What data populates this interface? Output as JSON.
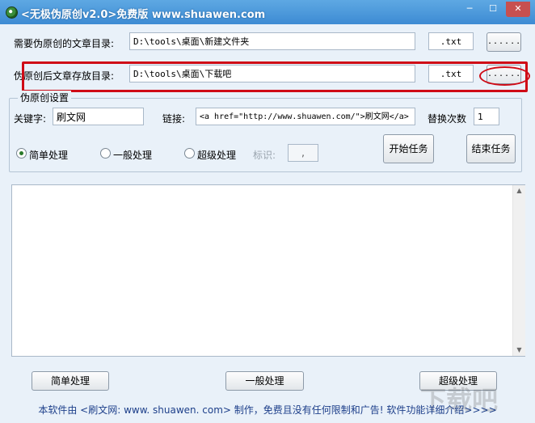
{
  "window": {
    "title": "<无极伪原创v2.0>免费版 www.shuawen.com",
    "controls": [
      "─",
      "☐",
      "✕"
    ]
  },
  "source_dir": {
    "label": "需要伪原创的文章目录:",
    "value": "D:\\tools\\桌面\\新建文件夹",
    "ext": ".txt",
    "browse": "......"
  },
  "target_dir": {
    "label": "伪原创后文章存放目录:",
    "value": "D:\\tools\\桌面\\下载吧",
    "ext": ".txt",
    "browse": "......"
  },
  "settings": {
    "group_title": "伪原创设置",
    "keyword_label": "关键字:",
    "keyword_value": "刷文网",
    "link_label": "链接:",
    "link_value": "<a href=\"http://www.shuawen.com/\">刷文网</a>",
    "replace_count_label": "替换次数",
    "replace_count_value": "1",
    "modes": [
      "简单处理",
      "一般处理",
      "超级处理"
    ],
    "selected_mode": "简单处理",
    "marker_label": "标识:",
    "marker_value": ",",
    "start_button": "开始任务",
    "stop_button": "结束任务"
  },
  "bottom_buttons": [
    "简单处理",
    "一般处理",
    "超级处理"
  ],
  "footer": "本软件由 <刷文网: www. shuawen. com> 制作，免费且没有任何限制和广告! 软件功能详细介绍>>>>",
  "watermark": "下载吧",
  "colors": {
    "titlebar": "#4a97da",
    "window_bg": "#e9f1f9",
    "highlight": "#cf0b16",
    "footer_text": "#1d3f8a"
  },
  "icons": [
    "app-icon",
    "minimize-icon",
    "maximize-icon",
    "close-icon",
    "scroll-up-arrow-icon",
    "scroll-down-arrow-icon"
  ]
}
